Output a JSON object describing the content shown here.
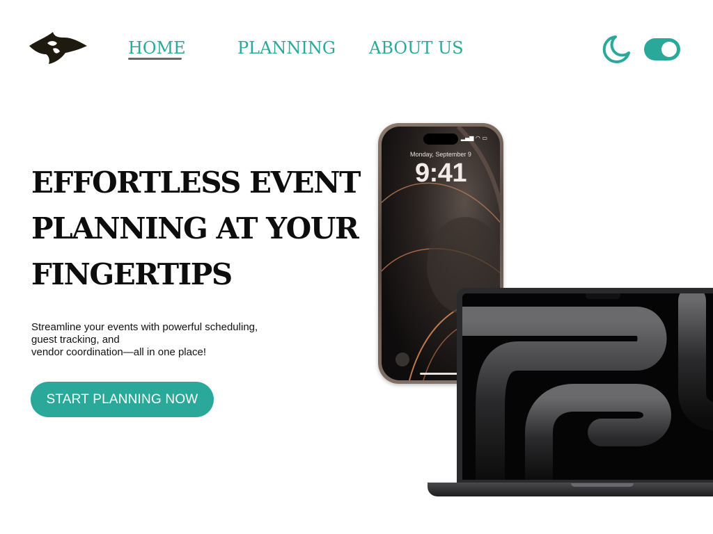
{
  "logo": {
    "icon": "horned-shield-logo",
    "color": "#1e1a0f"
  },
  "nav": {
    "items": [
      {
        "label": "HOME",
        "active": true
      },
      {
        "label": "PLANNING",
        "active": false
      },
      {
        "label": "ABOUT US",
        "active": false
      }
    ],
    "color": "#2aa89a"
  },
  "header_controls": {
    "moon_icon": "moon-icon",
    "toggle_on": true,
    "accent": "#2aa89a"
  },
  "hero": {
    "title_lines": [
      "EFFORTLESS EVENT",
      "PLANNING AT YOUR",
      "FINGERTIPS"
    ],
    "description_lines": [
      "Streamline your events with powerful scheduling,",
      "guest tracking, and",
      "vendor coordination—all in one place!"
    ],
    "cta_label": "START PLANNING NOW"
  },
  "devices": {
    "phone": {
      "date": "Monday, September 9",
      "time": "9:41"
    },
    "laptop": {
      "wallpaper": "dark-abstract-curves"
    }
  }
}
